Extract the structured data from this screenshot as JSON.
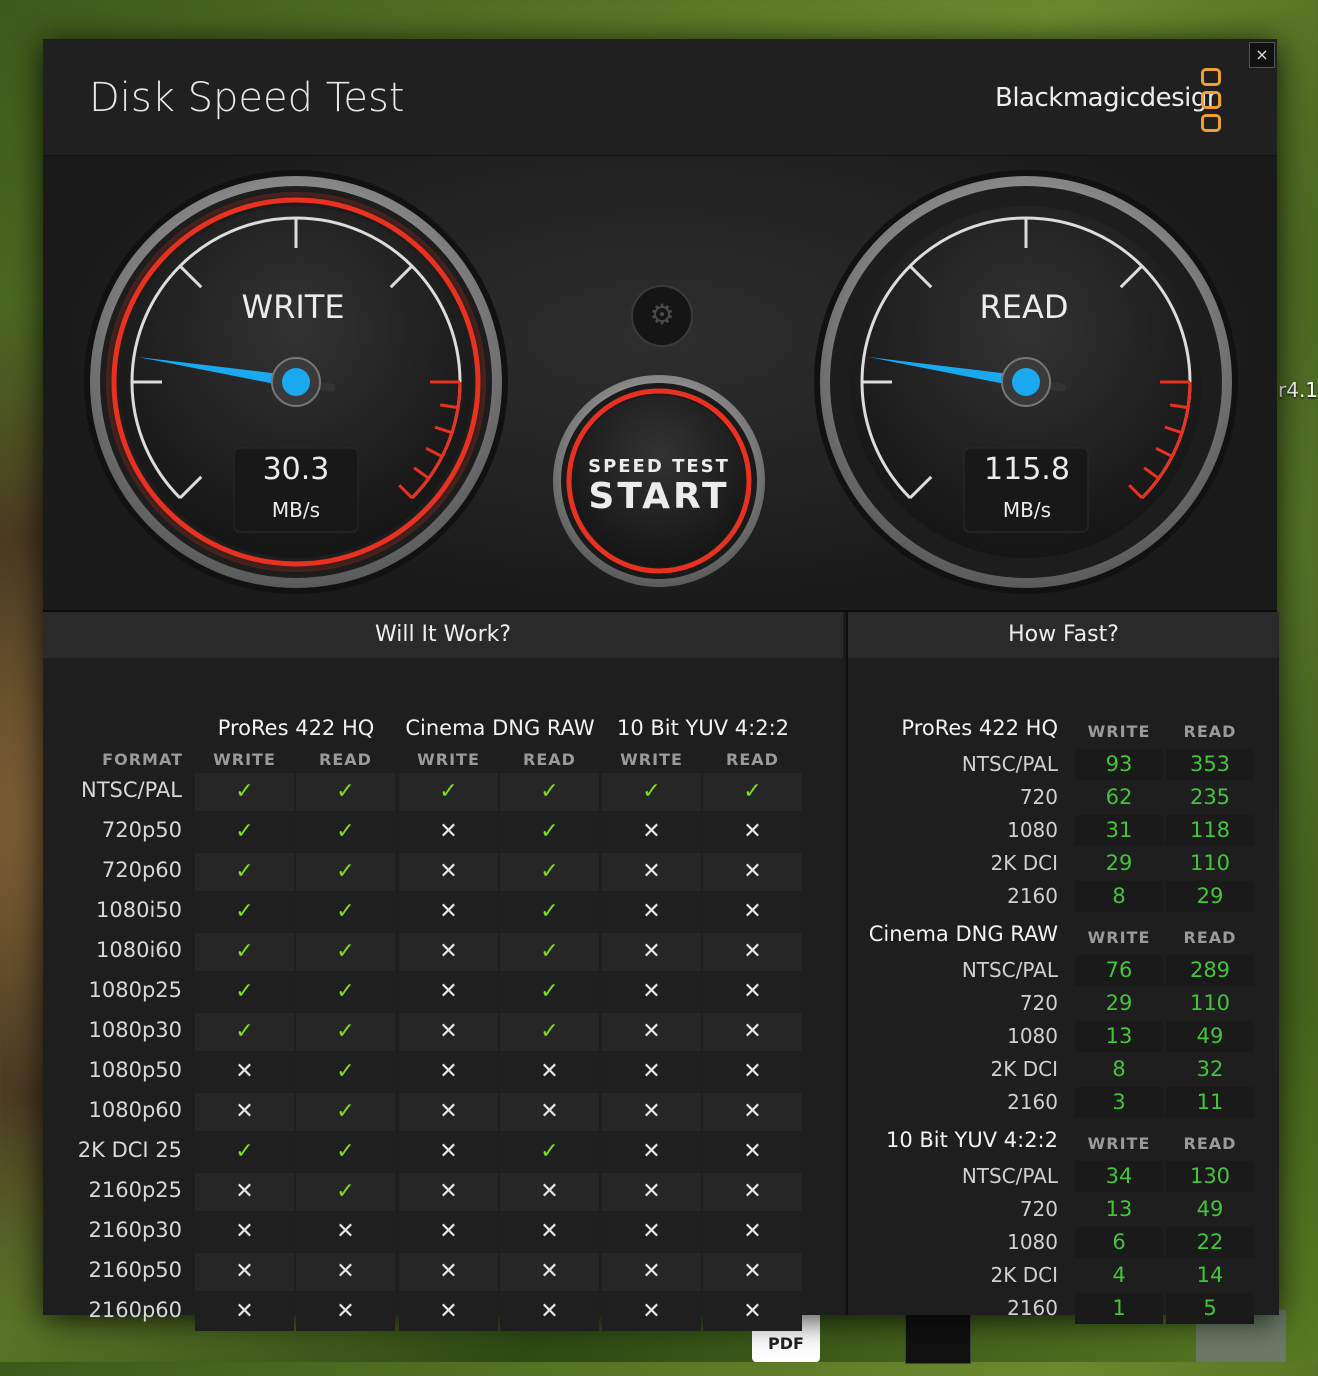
{
  "desktop": {
    "label": "r4.1",
    "pdf_label": "PDF"
  },
  "window": {
    "title": "Disk Speed Test",
    "brand": "Blackmagicdesign",
    "close": "×"
  },
  "gauges": {
    "write": {
      "label": "WRITE",
      "value": "30.3",
      "unit": "MB/s",
      "level": 0.2
    },
    "read": {
      "label": "READ",
      "value": "115.8",
      "unit": "MB/s",
      "level": 0.2
    },
    "start": {
      "small": "SPEED TEST",
      "big": "START"
    },
    "settings_icon": "gear-icon"
  },
  "will_it_work": {
    "title": "Will It Work?",
    "format_header": "FORMAT",
    "write_header": "WRITE",
    "read_header": "READ",
    "groups": [
      "ProRes 422 HQ",
      "Cinema DNG RAW",
      "10 Bit YUV 4:2:2"
    ],
    "rows": [
      {
        "format": "NTSC/PAL",
        "vals": [
          1,
          1,
          1,
          1,
          1,
          1
        ]
      },
      {
        "format": "720p50",
        "vals": [
          1,
          1,
          0,
          1,
          0,
          0
        ]
      },
      {
        "format": "720p60",
        "vals": [
          1,
          1,
          0,
          1,
          0,
          0
        ]
      },
      {
        "format": "1080i50",
        "vals": [
          1,
          1,
          0,
          1,
          0,
          0
        ]
      },
      {
        "format": "1080i60",
        "vals": [
          1,
          1,
          0,
          1,
          0,
          0
        ]
      },
      {
        "format": "1080p25",
        "vals": [
          1,
          1,
          0,
          1,
          0,
          0
        ]
      },
      {
        "format": "1080p30",
        "vals": [
          1,
          1,
          0,
          1,
          0,
          0
        ]
      },
      {
        "format": "1080p50",
        "vals": [
          0,
          1,
          0,
          0,
          0,
          0
        ]
      },
      {
        "format": "1080p60",
        "vals": [
          0,
          1,
          0,
          0,
          0,
          0
        ]
      },
      {
        "format": "2K DCI 25",
        "vals": [
          1,
          1,
          0,
          1,
          0,
          0
        ]
      },
      {
        "format": "2160p25",
        "vals": [
          0,
          1,
          0,
          0,
          0,
          0
        ]
      },
      {
        "format": "2160p30",
        "vals": [
          0,
          0,
          0,
          0,
          0,
          0
        ]
      },
      {
        "format": "2160p50",
        "vals": [
          0,
          0,
          0,
          0,
          0,
          0
        ]
      },
      {
        "format": "2160p60",
        "vals": [
          0,
          0,
          0,
          0,
          0,
          0
        ]
      }
    ],
    "yes_symbol": "✓",
    "no_symbol": "✕"
  },
  "how_fast": {
    "title": "How Fast?",
    "write_header": "WRITE",
    "read_header": "READ",
    "groups": [
      {
        "name": "ProRes 422 HQ",
        "rows": [
          {
            "label": "NTSC/PAL",
            "write": "93",
            "read": "353"
          },
          {
            "label": "720",
            "write": "62",
            "read": "235"
          },
          {
            "label": "1080",
            "write": "31",
            "read": "118"
          },
          {
            "label": "2K DCI",
            "write": "29",
            "read": "110"
          },
          {
            "label": "2160",
            "write": "8",
            "read": "29"
          }
        ]
      },
      {
        "name": "Cinema DNG RAW",
        "rows": [
          {
            "label": "NTSC/PAL",
            "write": "76",
            "read": "289"
          },
          {
            "label": "720",
            "write": "29",
            "read": "110"
          },
          {
            "label": "1080",
            "write": "13",
            "read": "49"
          },
          {
            "label": "2K DCI",
            "write": "8",
            "read": "32"
          },
          {
            "label": "2160",
            "write": "3",
            "read": "11"
          }
        ]
      },
      {
        "name": "10 Bit YUV 4:2:2",
        "rows": [
          {
            "label": "NTSC/PAL",
            "write": "34",
            "read": "130"
          },
          {
            "label": "720",
            "write": "13",
            "read": "49"
          },
          {
            "label": "1080",
            "write": "6",
            "read": "22"
          },
          {
            "label": "2K DCI",
            "write": "4",
            "read": "14"
          },
          {
            "label": "2160",
            "write": "1",
            "read": "5"
          }
        ]
      }
    ]
  },
  "colors": {
    "accent_red": "#e8321f",
    "needle_blue": "#1aa8f0",
    "ok_green": "#7ce01a",
    "num_green": "#43c43a",
    "brand_orange": "#f0a030"
  }
}
